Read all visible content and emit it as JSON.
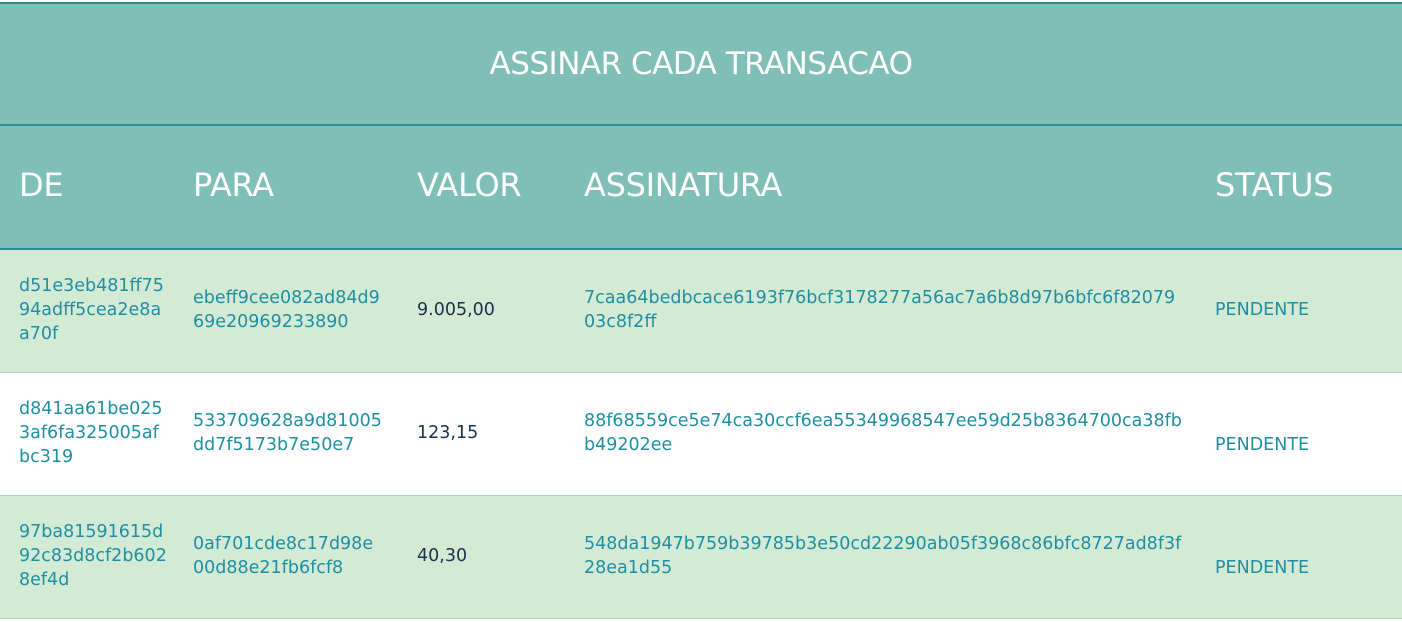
{
  "title": "ASSINAR CADA TRANSACAO",
  "columns": {
    "de": "DE",
    "para": "PARA",
    "valor": "VALOR",
    "assinatura": "ASSINATURA",
    "status": "STATUS"
  },
  "rows": [
    {
      "de": "d51e3eb481ff7594adff5cea2e8aa70f",
      "para": "ebeff9cee082ad84d969e20969233890",
      "valor": "9.005,00",
      "assinatura": "7caa64bedbcace6193f76bcf3178277a56ac7a6b8d97b6bfc6f8207903c8f2ff",
      "status": "PENDENTE"
    },
    {
      "de": "d841aa61be0253af6fa325005afbc319",
      "para": "533709628a9d81005dd7f5173b7e50e7",
      "valor": "123,15",
      "assinatura": "88f68559ce5e74ca30ccf6ea55349968547ee59d25b8364700ca38fbb49202ee",
      "status": "PENDENTE"
    },
    {
      "de": "97ba81591615d92c83d8cf2b6028ef4d",
      "para": "0af701cde8c17d98e00d88e21fb6fcf8",
      "valor": "40,30",
      "assinatura": "548da1947b759b39785b3e50cd22290ab05f3968c86bfc8727ad8f3f28ea1d55",
      "status": "PENDENTE"
    }
  ]
}
